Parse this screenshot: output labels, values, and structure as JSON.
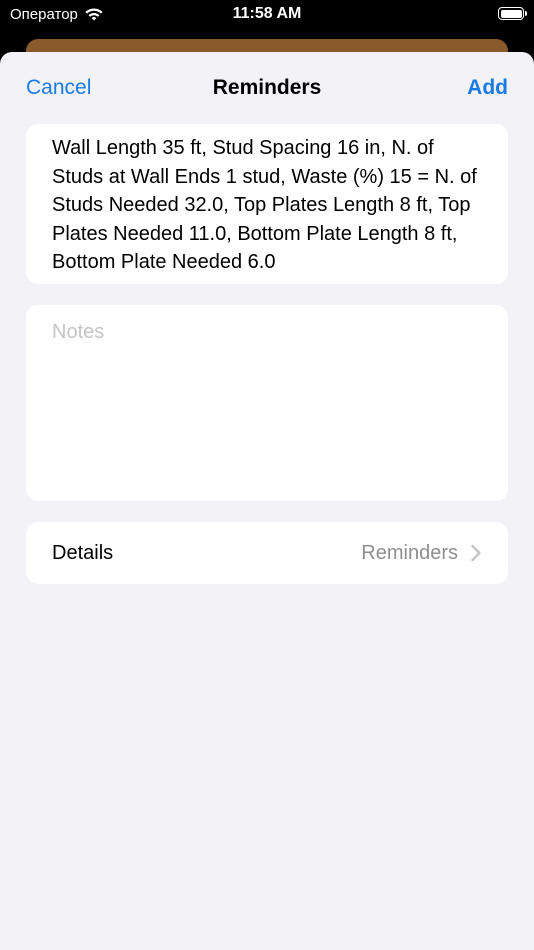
{
  "status_bar": {
    "carrier": "Оператор",
    "time": "11:58 AM",
    "icons": [
      "wifi-icon",
      "battery-icon"
    ]
  },
  "nav": {
    "cancel_label": "Cancel",
    "title": "Reminders",
    "add_label": "Add"
  },
  "reminder": {
    "title": "Wall Length 35 ft, Stud Spacing 16 in, N. of Studs at Wall Ends 1 stud, Waste (%) 15 = N. of Studs Needed 32.0, Top Plates Length 8 ft, Top Plates Needed 11.0, Bottom Plate Length 8 ft, Bottom Plate Needed 6.0",
    "notes_placeholder": "Notes"
  },
  "details": {
    "label": "Details",
    "value": "Reminders",
    "icon": "chevron-right-icon"
  },
  "colors": {
    "accent": "#1a7ae6",
    "sheet_background": "#f2f2f7",
    "peek_card": "#8a5a2b",
    "secondary_text": "#8e8e93",
    "placeholder_text": "#c4c4c7"
  }
}
